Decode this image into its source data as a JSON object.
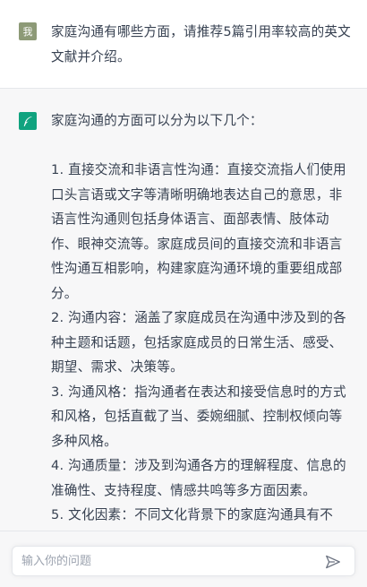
{
  "user_message": {
    "avatar_text": "我",
    "text": "家庭沟通有哪些方面，请推荐5篇引用率较高的英文文献并介绍。"
  },
  "assistant_message": {
    "avatar_icon": "feather-icon",
    "intro": "家庭沟通的方面可以分为以下几个：",
    "items": [
      "1. 直接交流和非语言性沟通：直接交流指人们使用口头言语或文字等清晰明确地表达自己的意思，非语言性沟通则包括身体语言、面部表情、肢体动作、眼神交流等。家庭成员间的直接交流和非语言性沟通互相影响，构建家庭沟通环境的重要组成部分。",
      "2. 沟通内容：涵盖了家庭成员在沟通中涉及到的各种主题和话题，包括家庭成员的日常生活、感受、期望、需求、决策等。",
      "3. 沟通风格：指沟通者在表达和接受信息时的方式和风格，包括直截了当、委婉细腻、控制权倾向等多种风格。",
      "4. 沟通质量：涉及到沟通各方的理解程度、信息的准确性、支持程度、情感共鸣等多方面因素。",
      "5. 文化因素：不同文化背景下的家庭沟通具有不"
    ]
  },
  "input": {
    "placeholder": "输入你的问题",
    "value": ""
  },
  "colors": {
    "user_avatar_bg": "#8d9a77",
    "bot_avatar_bg": "#10a37f",
    "assistant_bg": "#f7f7f8",
    "text": "#374151",
    "send_icon": "#6b7280"
  }
}
